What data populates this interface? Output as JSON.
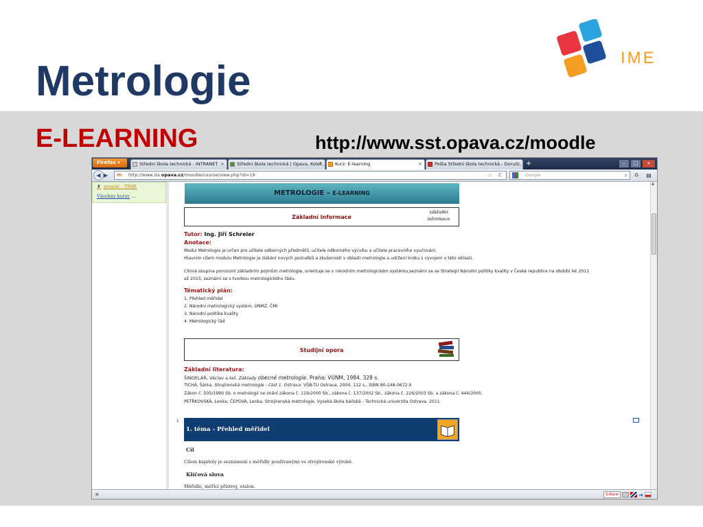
{
  "slide": {
    "title": "Metrologie",
    "subtitle": "E-LEARNING",
    "url": "http://www.sst.opava.cz/moodle",
    "logo_text": "IME",
    "colors": {
      "title": "#1f3864",
      "subtitle": "#c00000",
      "band": "#d8d8d8"
    }
  },
  "browser": {
    "firefox_label": "Firefox",
    "tabs": [
      {
        "label": "Střední škola technická - INTRANET"
      },
      {
        "label": "Střední škola technická | Opava, Kolof..."
      },
      {
        "label": "Kurz: E-learning"
      },
      {
        "label": "Pošta Střední škola technická - Doruč..."
      }
    ],
    "new_tab": "+",
    "address_favicon": "m",
    "address_prefix": "http://www.iss.",
    "address_host": "opava.cz",
    "address_path": "/moodle/course/view.php?id=19",
    "search_placeholder": "Google",
    "status_close": "×",
    "status_rank": "S-Rank"
  },
  "page": {
    "left": {
      "link1": "projekt - TIME",
      "link2": "Všechny kurzy",
      "link2_suffix": "..."
    },
    "banner_main": "METROLOGIE",
    "banner_sep": " – ",
    "banner_sub": "E-LEARNING",
    "basic_info": {
      "title": "Základní informace",
      "side_line1": "základní",
      "side_line2": "informace"
    },
    "tutor_label": "Tutor:",
    "tutor_name": "Ing. Jiří Schreier",
    "annotation_label": "Anotace:",
    "annotation_lines": [
      "Modul Metrologie je určen pro učitele odborných předmětů, učitele odborného výcviku a učitele pracovního vyučování.",
      "Hlavním cílem modulu Metrologie je získání nových poznatků a zkušeností v oblasti metrologie a udržení kroku s vývojem v této oblasti."
    ],
    "target_lines": [
      "Cílová skupina porozumí základním pojmům metrologie, orientuje se v národním metrologickém systému,seznámí se se Strategií Národní politiky kvality v České republice na období let 2011",
      "až 2015, seznámí se s tvorbou metrologického řádu."
    ],
    "plan_label": "Tématický plán:",
    "plan_items": [
      "1. Přehled měřidel",
      "2. Národní metrologický systém, ÚNMZ, ČMI",
      "3. Národní politika kvality",
      "4. Metrologický řád"
    ],
    "study": {
      "title": "Studijní opora"
    },
    "literature_label": "Základní literatura:",
    "lit1_a": "ŠINDELÁŘ, Václav a kol.",
    "lit1_b": "Základy",
    "lit1_c": "obecné metrologie",
    "lit1_d": ". Praha: VÚNM, 1984. 328 s.",
    "lit2_a": "TICHÁ, Šárka.",
    "lit2_b": "Strojírenská metrologie - část 1. Ostrava",
    "lit2_c": ": VŠB-TU Ostrava, 2004. 112 s., ISBN 80-248-0672-X",
    "lit3": "Zákon č. 505/1990 Sb. o metrologii ve znění zákona č. 119/2000 Sb., zákona č. 137/2002 Sb., zákona č. 226/2003 Sb. a zákona č. 444/2005.",
    "lit4": "PETŘKOVSKÁ, Lenka; ČEPOVÁ, Lenka. Strojírenská metrologie. Vysoká škola báňská - Technická univerzita Ostrava. 2011.",
    "topic": {
      "number": "1",
      "title": "1. téma - Přehled měřidel",
      "goal_label": "Cíl",
      "goal_text": "Cílem kapitoly je seznámení s měřidly používanými ve strojírenské výrobě.",
      "keywords_label": "Klíčová slova",
      "keywords_text": "Měřidlo, měřící přístroj, etalon."
    }
  }
}
